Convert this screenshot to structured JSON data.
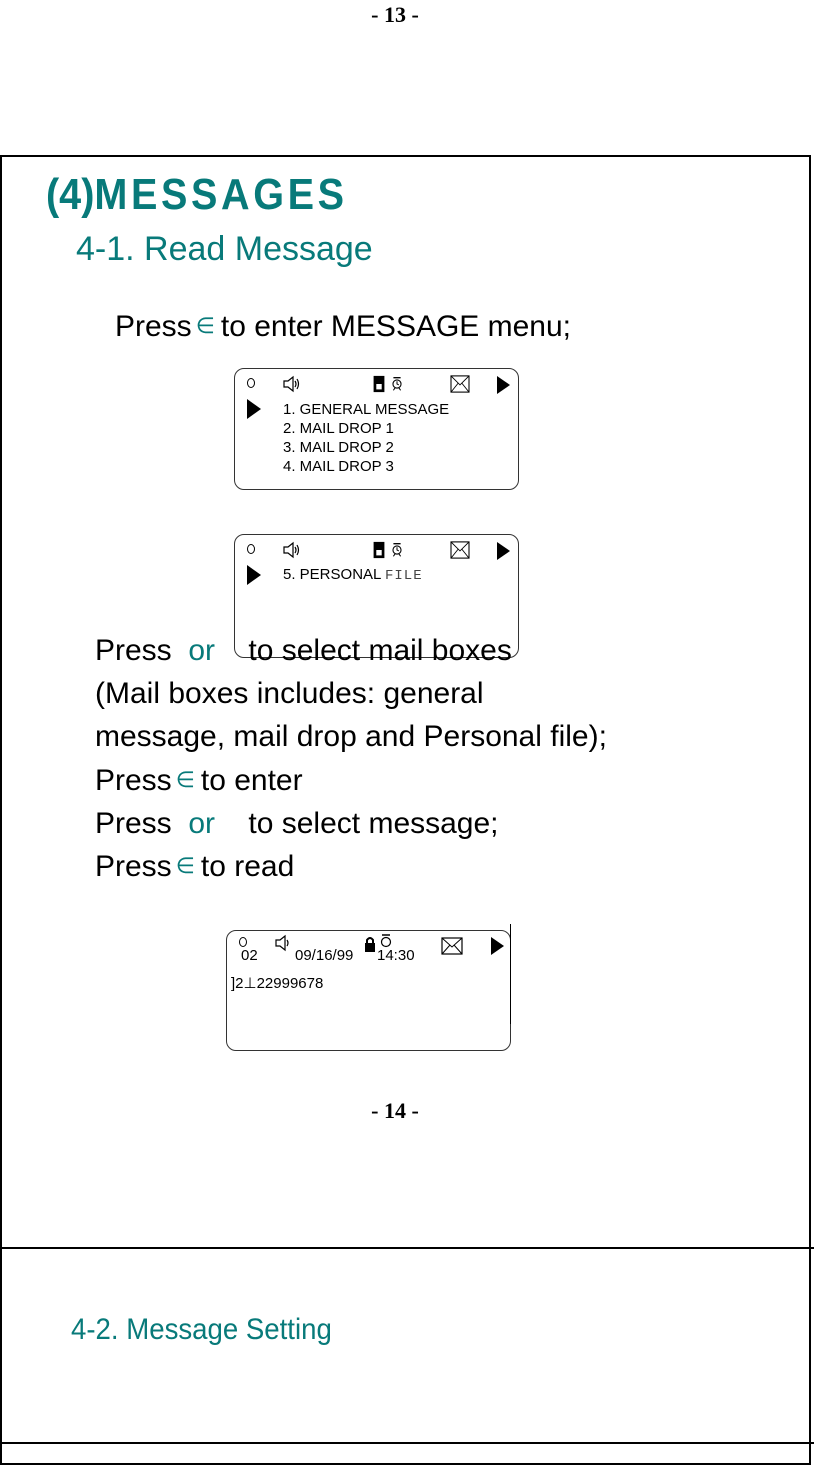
{
  "page_top_number": "- 13 -",
  "page_bottom_number": "- 14 -",
  "section_title": {
    "prefix": "(4)",
    "text": "MESSAGES"
  },
  "subsection_1": "4-1. Read Message",
  "subsection_2": "4-2. Message Setting",
  "colors": {
    "accent": "#087a7a",
    "text": "#000000"
  },
  "intro_line": {
    "press": "Press",
    "key_symbol": "∈",
    "rest": "to enter MESSAGE menu;"
  },
  "lcd_status_icons": [
    "ring-indicator",
    "speaker-icon",
    "lock-icon",
    "alarm-clock-icon",
    "envelope-icon",
    "right-arrow-icon"
  ],
  "screen_1": {
    "items": [
      "1.    GENERAL MESSAGE",
      "2.    MAIL DROP  1",
      "3.    MAIL DROP  2",
      "4.  MAIL DROP  3"
    ]
  },
  "screen_2": {
    "item_main": "5.  PERSONAL",
    "item_suffix": "FILE"
  },
  "instructions": [
    {
      "id": "select-mailboxes",
      "a": "Press",
      "or": "or",
      "b": "to select mail boxes"
    },
    {
      "id": "mailbox-note-1",
      "text": "(Mail boxes includes: general"
    },
    {
      "id": "mailbox-note-2",
      "text": "message, mail drop and Personal file);"
    },
    {
      "id": "enter",
      "a": "Press",
      "sym": "∈",
      "b": "to enter"
    },
    {
      "id": "select-message",
      "a": "Press",
      "or": "or",
      "b": "to select message;"
    },
    {
      "id": "read",
      "a": "Press",
      "sym": "∈",
      "b": "to read"
    }
  ],
  "screen_3": {
    "index": "02",
    "date": "09/16/99",
    "time": "14:30",
    "number": "]2⊥22999678"
  }
}
